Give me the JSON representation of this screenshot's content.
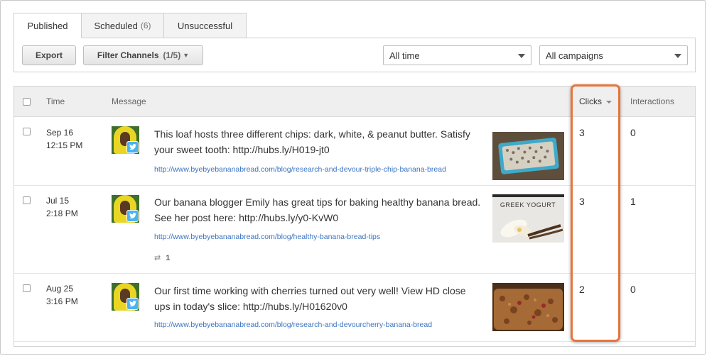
{
  "tabs": [
    {
      "label": "Published",
      "count": "",
      "active": true
    },
    {
      "label": "Scheduled",
      "count": "(6)",
      "active": false
    },
    {
      "label": "Unsuccessful",
      "count": "",
      "active": false
    }
  ],
  "toolbar": {
    "export_label": "Export",
    "filter_label": "Filter Channels",
    "filter_count": "(1/5)",
    "time_select": "All time",
    "campaign_select": "All campaigns"
  },
  "table": {
    "headers": {
      "time": "Time",
      "message": "Message",
      "clicks": "Clicks",
      "interactions": "Interactions"
    },
    "rows": [
      {
        "date": "Sep 16",
        "time": "12:15 PM",
        "message": "This loaf hosts three different chips: dark, white, & peanut butter. Satisfy your sweet tooth: http://hubs.ly/H019-jt0",
        "url": "http://www.byebyebananabread.com/blog/research-and-devour-triple-chip-banana-bread",
        "clicks": "3",
        "interactions": "0",
        "retweets": ""
      },
      {
        "date": "Jul 15",
        "time": "2:18 PM",
        "message": "Our banana blogger Emily has great tips for baking healthy banana bread. See her post here: http://hubs.ly/y0-KvW0",
        "url": "http://www.byebyebananabread.com/blog/healthy-banana-bread-tips",
        "clicks": "3",
        "interactions": "1",
        "retweets": "1",
        "thumb_text": "GREEK YOGURT"
      },
      {
        "date": "Aug 25",
        "time": "3:16 PM",
        "message": "Our first time working with cherries turned out very well! View HD close ups in today's slice: http://hubs.ly/H01620v0",
        "url": "http://www.byebyebananabread.com/blog/research-and-devourcherry-banana-bread",
        "clicks": "2",
        "interactions": "0",
        "retweets": ""
      }
    ]
  },
  "colors": {
    "highlight": "#e8743b",
    "link": "#3b74c2",
    "twitter": "#4ab3f4"
  }
}
